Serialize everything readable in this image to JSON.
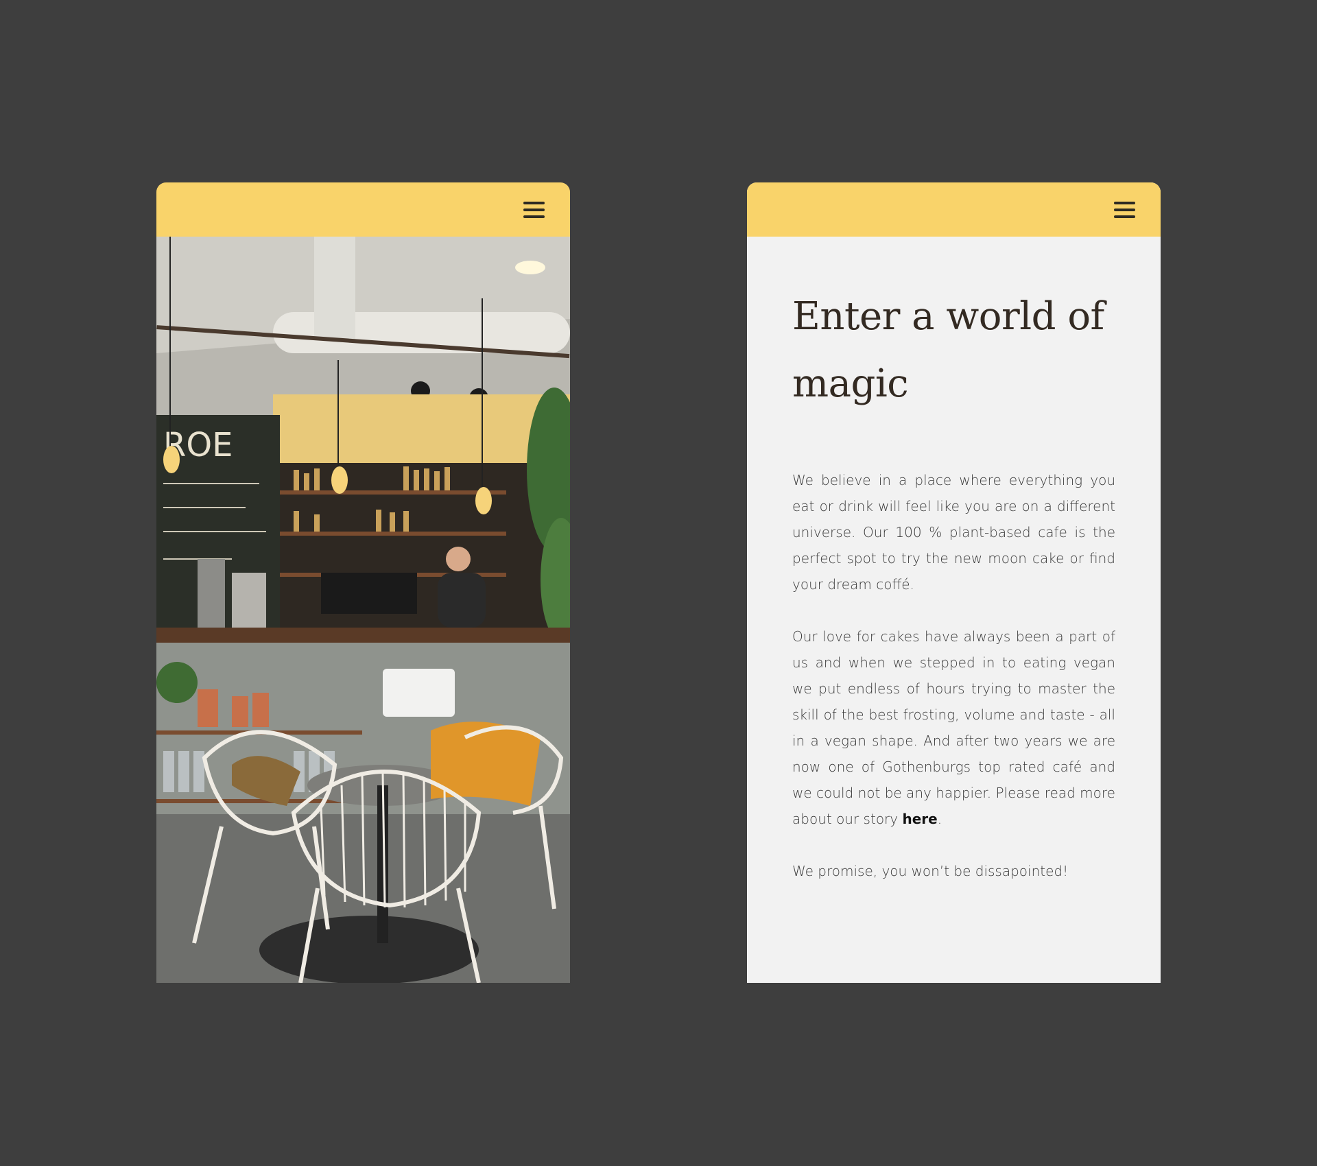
{
  "left_screen": {
    "menu_icon": "hamburger-menu-icon",
    "image_alt": "cafe-interior-photo"
  },
  "right_screen": {
    "menu_icon": "hamburger-menu-icon",
    "headline": "Enter a world of magic",
    "paragraph_1": "We believe in a place where everything you eat or drink will feel like you are on a different universe.  Our 100 % plant-based cafe is the perfect spot to try the new moon cake or find your dream coffé.",
    "paragraph_2_text": "Our love for cakes have always been a part of us and when we stepped in to eating vegan we put endless of hours trying to master the skill of the best frosting, volume and taste - all in a vegan shape. And after two years we are now one of Gothenburgs top rated café and we could not be any happier. Please read more about our story ",
    "paragraph_2_link": "here",
    "paragraph_2_end": ".",
    "paragraph_3": "We promise, you won’t be dissapointed!"
  },
  "colors": {
    "background": "#3e3e3e",
    "header_yellow": "#f9d36a",
    "panel": "#f2f2f2",
    "text_dark": "#332a22"
  }
}
